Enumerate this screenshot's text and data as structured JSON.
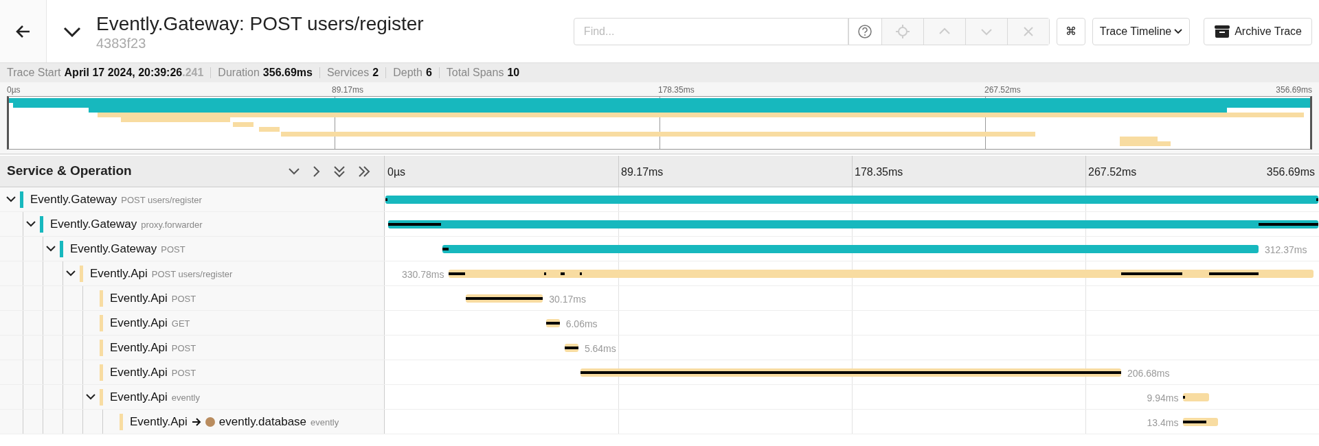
{
  "header": {
    "title": "Evently.Gateway: POST users/register",
    "trace_id": "4383f23",
    "expanded": true,
    "find": {
      "placeholder": "Find...",
      "buttons": [
        {
          "kind": "help",
          "disabled": false
        },
        {
          "kind": "locate",
          "disabled": true
        },
        {
          "kind": "up",
          "disabled": true
        },
        {
          "kind": "down",
          "disabled": true
        },
        {
          "kind": "clear",
          "disabled": true
        }
      ]
    },
    "shortcut_key": "⌘",
    "view_dropdown": "Trace Timeline",
    "archive_button": "Archive Trace"
  },
  "summary": [
    {
      "label": "Trace Start",
      "value": "April 17 2024, 20:39:26",
      "suffix": ".241"
    },
    {
      "label": "Duration",
      "value": "356.69ms"
    },
    {
      "label": "Services",
      "value": "2"
    },
    {
      "label": "Depth",
      "value": "6"
    },
    {
      "label": "Total Spans",
      "value": "10"
    }
  ],
  "minimap_ticks": [
    "0µs",
    "89.17ms",
    "178.35ms",
    "267.52ms",
    "356.69ms"
  ],
  "timeline_ticks": [
    "0µs",
    "89.17ms",
    "178.35ms",
    "267.52ms",
    "356.69ms"
  ],
  "tree_header": "Service & Operation",
  "spans": [
    {
      "service": "Evently.Gateway",
      "operation": "POST users/register",
      "color": "#17b8be",
      "expanded": true,
      "children": [
        {
          "service": "Evently.Gateway",
          "operation": "proxy.forwarder",
          "color": "#17b8be",
          "expanded": true,
          "children": [
            {
              "service": "Evently.Gateway",
              "operation": "POST",
              "color": "#17b8be",
              "duration": "312.37ms",
              "expanded": true,
              "children": [
                {
                  "service": "Evently.Api",
                  "operation": "POST users/register",
                  "color": "#f8dca1",
                  "duration": "330.78ms",
                  "expanded": true,
                  "children": [
                    {
                      "service": "Evently.Api",
                      "operation": "POST",
                      "color": "#f8dca1",
                      "duration": "30.17ms"
                    },
                    {
                      "service": "Evently.Api",
                      "operation": "GET",
                      "color": "#f8dca1",
                      "duration": "6.06ms"
                    },
                    {
                      "service": "Evently.Api",
                      "operation": "POST",
                      "color": "#f8dca1",
                      "duration": "5.64ms"
                    },
                    {
                      "service": "Evently.Api",
                      "operation": "POST",
                      "color": "#f8dca1",
                      "duration": "206.68ms"
                    },
                    {
                      "service": "Evently.Api",
                      "operation": "evently",
                      "color": "#f8dca1",
                      "duration": "9.94ms",
                      "expanded": true,
                      "children": [
                        {
                          "service": "Evently.Api",
                          "operation": "evently",
                          "color": "#f8dca1",
                          "duration": "13.4ms",
                          "peer": {
                            "name": "evently.database",
                            "color": "#b98c5e"
                          }
                        }
                      ]
                    }
                  ]
                }
              ]
            }
          ]
        }
      ]
    }
  ]
}
